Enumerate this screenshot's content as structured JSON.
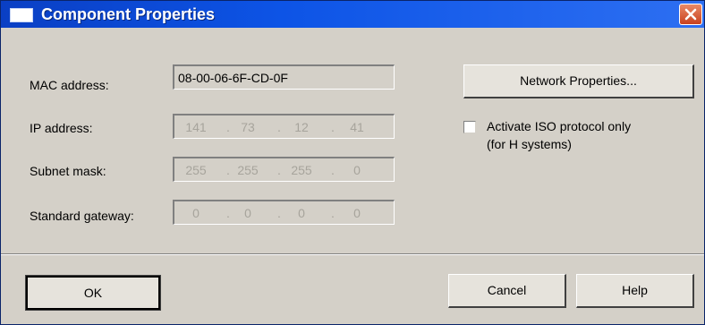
{
  "window": {
    "title": "Component Properties"
  },
  "fields": {
    "mac": {
      "label": "MAC address:",
      "value": "08-00-06-6F-CD-0F"
    },
    "ip": {
      "label": "IP address:",
      "octets": [
        "141",
        "73",
        "12",
        "41"
      ]
    },
    "subnet": {
      "label": "Subnet mask:",
      "octets": [
        "255",
        "255",
        "255",
        "0"
      ]
    },
    "gateway": {
      "label": "Standard gateway:",
      "octets": [
        "0",
        "0",
        "0",
        "0"
      ]
    }
  },
  "network_button": {
    "label": "Network Properties..."
  },
  "iso_checkbox": {
    "line1": "Activate ISO protocol only",
    "line2": "(for H systems)",
    "checked": false
  },
  "buttons": {
    "ok": "OK",
    "cancel": "Cancel",
    "help": "Help"
  },
  "dot": "."
}
